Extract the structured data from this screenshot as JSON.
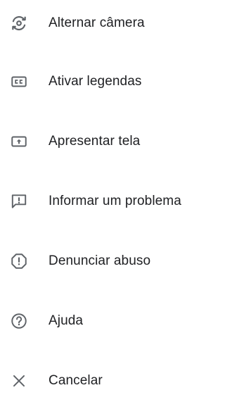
{
  "menu": {
    "items": [
      {
        "label": "Alternar câmera",
        "icon": "switch-camera-icon"
      },
      {
        "label": "Ativar legendas",
        "icon": "closed-captions-icon"
      },
      {
        "label": "Apresentar tela",
        "icon": "present-screen-icon"
      },
      {
        "label": "Informar um problema",
        "icon": "report-problem-icon"
      },
      {
        "label": "Denunciar abuso",
        "icon": "report-abuse-icon"
      },
      {
        "label": "Ajuda",
        "icon": "help-icon"
      },
      {
        "label": "Cancelar",
        "icon": "close-icon"
      }
    ]
  },
  "colors": {
    "text": "#202124",
    "icon": "#5f6368",
    "background": "#ffffff"
  }
}
